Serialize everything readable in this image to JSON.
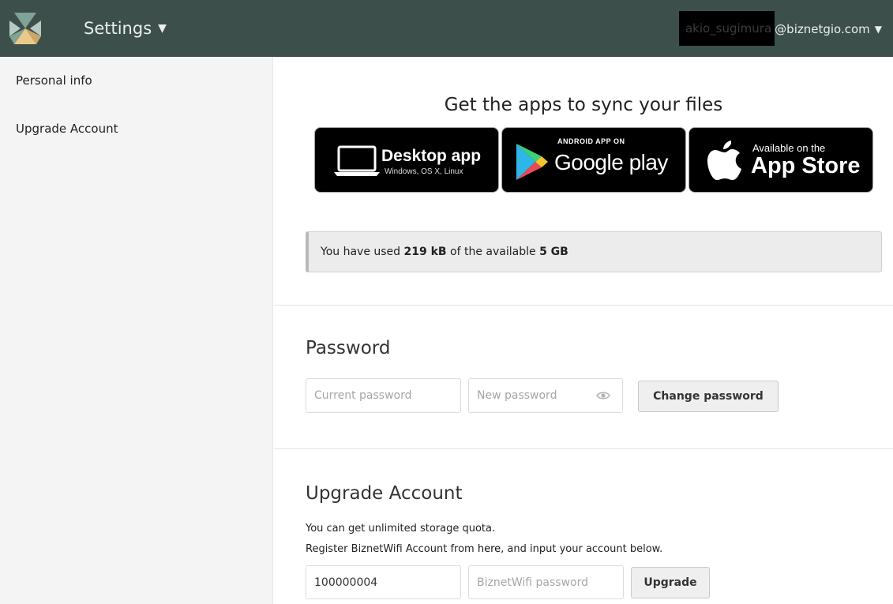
{
  "header": {
    "app_menu_label": "Settings",
    "user_redacted": "akio_sugimura",
    "user_domain": "@biznetgio.com",
    "caret": "▼"
  },
  "sidebar": {
    "items": [
      {
        "label": "Personal info"
      },
      {
        "label": "Upgrade Account"
      }
    ]
  },
  "apps": {
    "title": "Get the apps to sync your files",
    "desktop": {
      "main": "Desktop app",
      "sub": "Windows, OS X, Linux"
    },
    "android": {
      "top": "ANDROID APP ON",
      "main": "Google play"
    },
    "ios": {
      "top": "Available on the",
      "main": "App Store"
    }
  },
  "quota": {
    "prefix": "You have used ",
    "used": "219 kB",
    "middle": " of the available ",
    "total": "5 GB"
  },
  "password": {
    "title": "Password",
    "current_placeholder": "Current password",
    "new_placeholder": "New password",
    "button": "Change password"
  },
  "upgrade": {
    "title": "Upgrade Account",
    "line1": "You can get unlimited storage quota.",
    "line2_before": "Register BiznetWifi Account from ",
    "line2_link": "here",
    "line2_after": ", and input your account below.",
    "account_value": "100000004",
    "password_placeholder": "BiznetWifi password",
    "button": "Upgrade"
  },
  "colors": {
    "header_bg": "#3d4f4b",
    "sidebar_bg": "#f4f4f4",
    "logo_green": "#7fa394",
    "logo_sand": "#e9c98b"
  }
}
